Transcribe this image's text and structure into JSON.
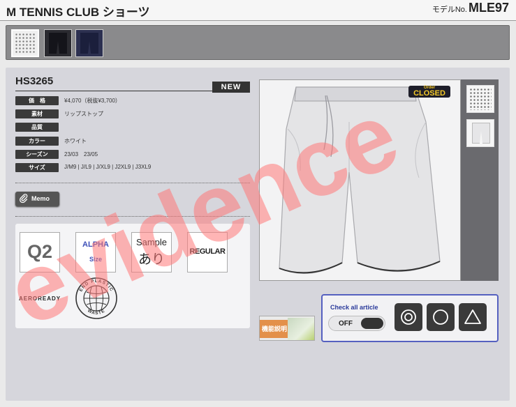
{
  "header": {
    "title": "M TENNIS CLUB ショーツ",
    "model_label": "モデルNo.",
    "model_number": "MLE97"
  },
  "color_swatches": [
    {
      "name": "white-dots-swatch",
      "selected": true
    },
    {
      "name": "black-swatch",
      "selected": false
    },
    {
      "name": "navy-swatch",
      "selected": false
    }
  ],
  "product": {
    "code": "HS3265",
    "badge": "NEW",
    "specs": [
      {
        "label": "価　格",
        "value": "¥4,070（税抜¥3,700）"
      },
      {
        "label": "素材",
        "value": "リップストップ"
      },
      {
        "label": "品質",
        "value": ""
      },
      {
        "label": "カラー",
        "value": "ホワイト"
      },
      {
        "label": "シーズン",
        "value": "23/03　23/05"
      },
      {
        "label": "サイズ",
        "value": "J/M9 | J/L9 | J/XL9 | J2XL9 | J3XL9"
      }
    ]
  },
  "memo_label": "Memo",
  "icons": {
    "q2": "Q2",
    "alpha_line1": "ALPHA",
    "alpha_line2": "Size",
    "sample_line1": "Sample",
    "sample_line2": "あり",
    "regular": "REGULAR",
    "aeroready": "AEROREADY",
    "plastic_top": "END PLASTIC",
    "plastic_bottom": "WASTE"
  },
  "order_badge": {
    "line1": "Order",
    "line2": "CLOSED"
  },
  "function_label": "機能説明",
  "check": {
    "title": "Check all article",
    "toggle": "OFF"
  },
  "watermark": "evidence",
  "colors": {
    "accent_blue": "#5560c0",
    "new_badge": "#333333",
    "order_badge_text": "#f4c928",
    "function_orange": "#e3904a"
  }
}
